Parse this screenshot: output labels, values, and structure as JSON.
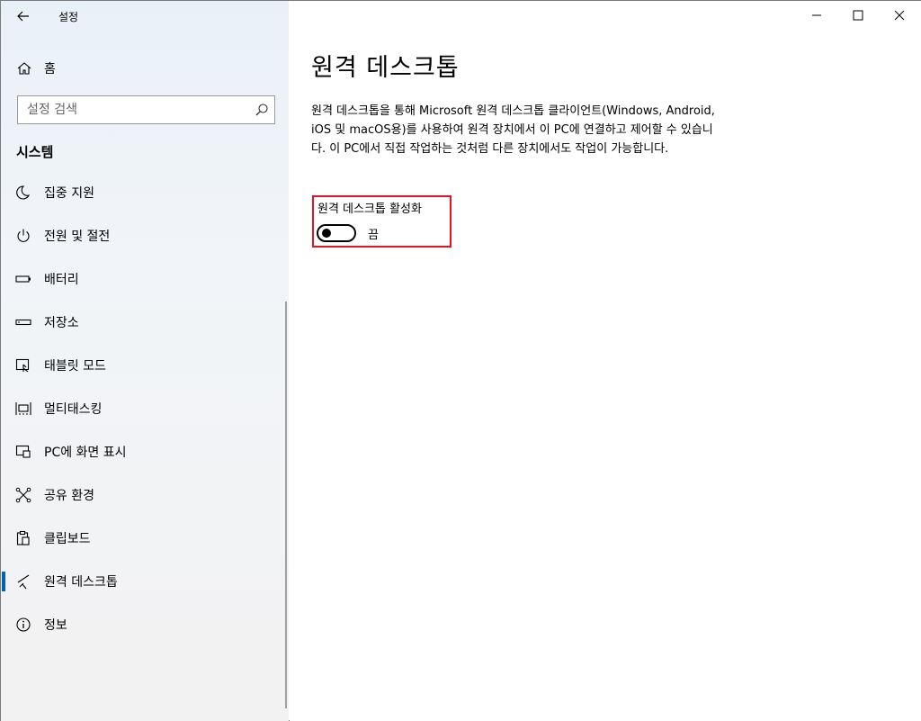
{
  "window": {
    "title": "설정",
    "controls": {
      "minimize": "minimize-icon",
      "maximize": "maximize-icon",
      "close": "close-icon"
    }
  },
  "sidebar": {
    "home_label": "홈",
    "search_placeholder": "설정 검색",
    "section_title": "시스템",
    "items": [
      {
        "label": "집중 지원",
        "icon": "moon-icon"
      },
      {
        "label": "전원 및 절전",
        "icon": "power-icon"
      },
      {
        "label": "배터리",
        "icon": "battery-icon"
      },
      {
        "label": "저장소",
        "icon": "storage-icon"
      },
      {
        "label": "태블릿 모드",
        "icon": "tablet-mode-icon"
      },
      {
        "label": "멀티태스킹",
        "icon": "multitasking-icon"
      },
      {
        "label": "PC에 화면 표시",
        "icon": "project-icon"
      },
      {
        "label": "공유 환경",
        "icon": "shared-experiences-icon"
      },
      {
        "label": "클립보드",
        "icon": "clipboard-icon"
      },
      {
        "label": "원격 데스크톱",
        "icon": "remote-desktop-icon",
        "active": true
      },
      {
        "label": "정보",
        "icon": "info-icon"
      }
    ]
  },
  "main": {
    "title": "원격 데스크톱",
    "description": "원격 데스크톱을 통해 Microsoft 원격 데스크톱 클라이언트(Windows, Android, iOS 및 macOS용)를 사용하여 원격 장치에서 이 PC에 연결하고 제어할 수 있습니다. 이 PC에서 직접 작업하는 것처럼 다른 장치에서도 작업이 가능합니다.",
    "toggle": {
      "label": "원격 데스크톱 활성화",
      "state": "끔",
      "on": false
    },
    "highlight_color": "#e81123"
  },
  "colors": {
    "accent": "#0063b1"
  }
}
